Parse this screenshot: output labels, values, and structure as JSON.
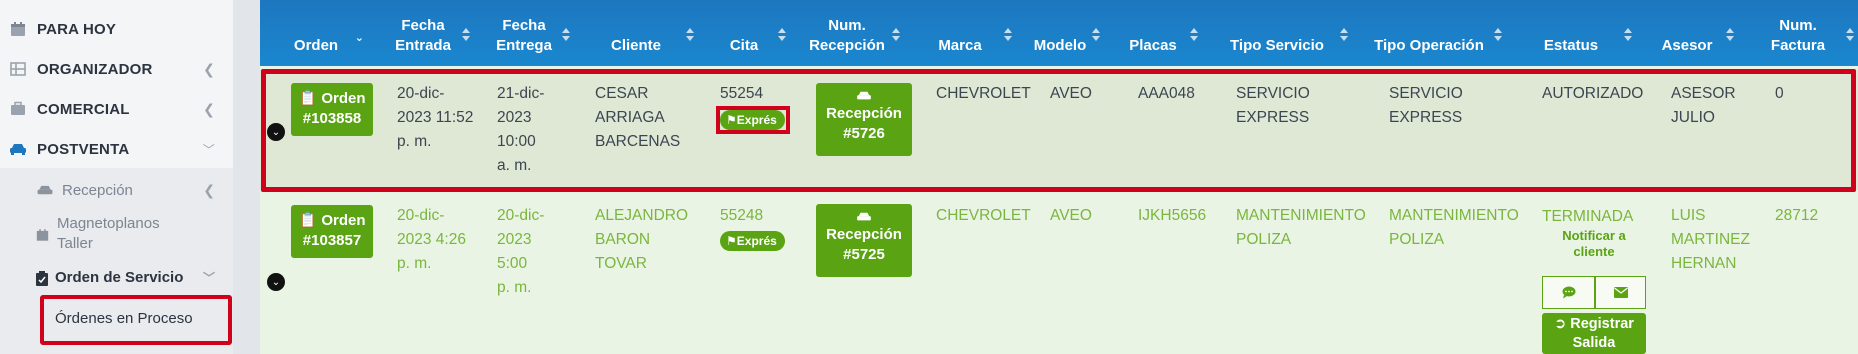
{
  "sidebar": {
    "items": [
      {
        "label": "PARA HOY",
        "icon": "calendar-icon"
      },
      {
        "label": "ORGANIZADOR",
        "icon": "grid-icon"
      },
      {
        "label": "COMERCIAL",
        "icon": "briefcase-icon"
      },
      {
        "label": "POSTVENTA",
        "icon": "car-icon"
      }
    ],
    "sub": {
      "recepcion": "Recepción",
      "magnetoplanos_line1": "Magnetoplanos",
      "magnetoplanos_line2": "Taller",
      "orden_servicio": "Orden de Servicio",
      "ordenes_proceso": "Órdenes en Proceso"
    }
  },
  "table": {
    "headers": [
      {
        "l1": "",
        "l2": "Orden"
      },
      {
        "l1": "Fecha",
        "l2": "Entrada"
      },
      {
        "l1": "Fecha",
        "l2": "Entrega"
      },
      {
        "l1": "",
        "l2": "Cliente"
      },
      {
        "l1": "",
        "l2": "Cita"
      },
      {
        "l1": "Num.",
        "l2": "Recepción"
      },
      {
        "l1": "",
        "l2": "Marca"
      },
      {
        "l1": "",
        "l2": "Modelo"
      },
      {
        "l1": "",
        "l2": "Placas"
      },
      {
        "l1": "",
        "l2": "Tipo Servicio"
      },
      {
        "l1": "",
        "l2": "Tipo Operación"
      },
      {
        "l1": "",
        "l2": "Estatus"
      },
      {
        "l1": "",
        "l2": "Asesor"
      },
      {
        "l1": "Num.",
        "l2": "Factura"
      }
    ],
    "rows": [
      {
        "orden_l1": "Orden",
        "orden_l2": "#103858",
        "entrada": [
          "20-dic-",
          "2023 11:52",
          "p. m."
        ],
        "entrega": [
          "21-dic-",
          "2023",
          "10:00",
          "a. m."
        ],
        "cliente": [
          "CESAR",
          "ARRIAGA",
          "BARCENAS"
        ],
        "cita": "55254",
        "cita_badge": "Exprés",
        "recepcion_l1": "Recepción",
        "recepcion_l2": "#5726",
        "marca": "CHEVROLET",
        "modelo": "AVEO",
        "placas": "AAA048",
        "tipo_servicio": [
          "SERVICIO",
          "EXPRESS"
        ],
        "tipo_operacion": [
          "SERVICIO",
          "EXPRESS"
        ],
        "estatus": "AUTORIZADO",
        "asesor": [
          "ASESOR",
          "JULIO"
        ],
        "factura": "0"
      },
      {
        "orden_l1": "Orden",
        "orden_l2": "#103857",
        "entrada": [
          "20-dic-",
          "2023 4:26",
          "p. m."
        ],
        "entrega": [
          "20-dic-",
          "2023",
          "5:00",
          "p. m."
        ],
        "cliente": [
          "ALEJANDRO",
          "BARON",
          "TOVAR"
        ],
        "cita": "55248",
        "cita_badge": "Exprés",
        "recepcion_l1": "Recepción",
        "recepcion_l2": "#5725",
        "marca": "CHEVROLET",
        "modelo": "AVEO",
        "placas": "IJKH5656",
        "tipo_servicio": [
          "MANTENIMIENTO",
          "POLIZA"
        ],
        "tipo_operacion": [
          "MANTENIMIENTO",
          "POLIZA"
        ],
        "estatus": "TERMINADA",
        "notificar": [
          "Notificar a",
          "cliente"
        ],
        "registrar": [
          "Registrar",
          "Salida"
        ],
        "asesor": [
          "LUIS",
          "MARTINEZ",
          "HERNAN"
        ],
        "factura": "28712"
      }
    ]
  },
  "colors": {
    "header": "#1d77bf",
    "accent": "#5aa414",
    "highlight": "#d0021b"
  }
}
